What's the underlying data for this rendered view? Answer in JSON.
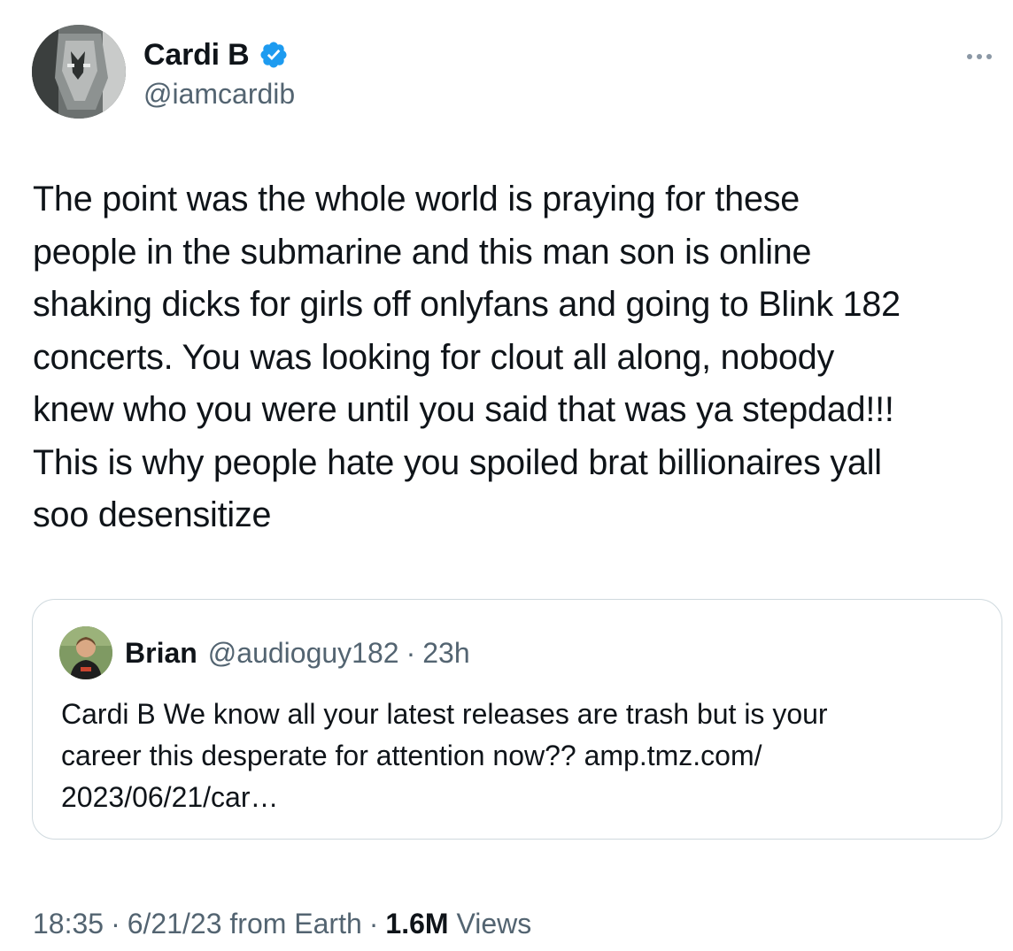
{
  "author": {
    "display_name": "Cardi B",
    "handle": "@iamcardib",
    "verified_icon": "verified-badge-icon",
    "avatar_icon": "masked-figure-avatar"
  },
  "more_icon": "more-options-icon",
  "tweet": {
    "text": "The point was the whole world is praying for these\npeople in the submarine and this man son is online\nshaking dicks for girls off onlyfans and going to Blink 182\nconcerts. You was looking for clout all along, nobody\nknew who you were until you said that was ya stepdad!!!\nThis is why people hate you spoiled brat billionaires yall\nsoo desensitize"
  },
  "quote": {
    "display_name": "Brian",
    "handle": "@audioguy182",
    "separator": "·",
    "time": "23h",
    "text": "Cardi B We know all your latest releases are trash but is your\ncareer this desperate for attention now?? amp.tmz.com/\n2023/06/21/car…"
  },
  "meta": {
    "time": "18:35",
    "separator": "·",
    "date": "6/21/23 from Earth",
    "views_count": "1.6M",
    "views_label": "Views"
  },
  "colors": {
    "text": "#0f1419",
    "secondary": "#536471",
    "verified": "#1d9bf0",
    "border": "#cfd9de"
  }
}
